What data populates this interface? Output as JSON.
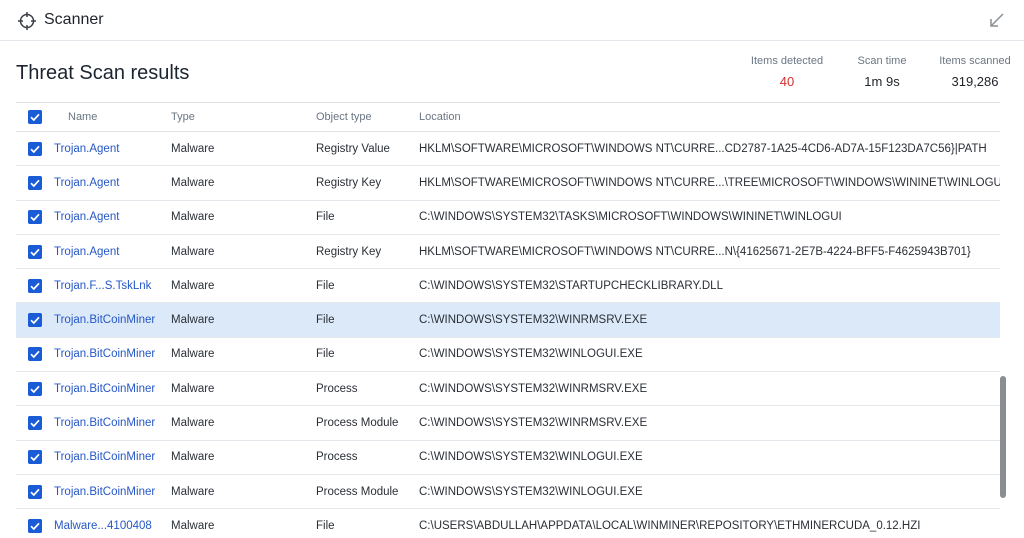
{
  "window": {
    "title": "Scanner"
  },
  "page": {
    "heading": "Threat Scan results"
  },
  "stats": {
    "detected_label": "Items detected",
    "detected_value": "40",
    "time_label": "Scan time",
    "time_value": "1m 9s",
    "scanned_label": "Items scanned",
    "scanned_value": "319,286"
  },
  "table": {
    "headers": {
      "name": "Name",
      "type": "Type",
      "object_type": "Object type",
      "location": "Location"
    },
    "rows": [
      {
        "name": "Trojan.Agent",
        "type": "Malware",
        "object_type": "Registry Value",
        "location": "HKLM\\SOFTWARE\\MICROSOFT\\WINDOWS NT\\CURRE...CD2787-1A25-4CD6-AD7A-15F123DA7C56}|PATH"
      },
      {
        "name": "Trojan.Agent",
        "type": "Malware",
        "object_type": "Registry Key",
        "location": "HKLM\\SOFTWARE\\MICROSOFT\\WINDOWS NT\\CURRE...\\TREE\\MICROSOFT\\WINDOWS\\WININET\\WINLOGUI"
      },
      {
        "name": "Trojan.Agent",
        "type": "Malware",
        "object_type": "File",
        "location": "C:\\WINDOWS\\SYSTEM32\\TASKS\\MICROSOFT\\WINDOWS\\WININET\\WINLOGUI"
      },
      {
        "name": "Trojan.Agent",
        "type": "Malware",
        "object_type": "Registry Key",
        "location": "HKLM\\SOFTWARE\\MICROSOFT\\WINDOWS NT\\CURRE...N\\{41625671-2E7B-4224-BFF5-F4625943B701}"
      },
      {
        "name": "Trojan.F...S.TskLnk",
        "type": "Malware",
        "object_type": "File",
        "location": "C:\\WINDOWS\\SYSTEM32\\STARTUPCHECKLIBRARY.DLL"
      },
      {
        "name": "Trojan.BitCoinMiner",
        "type": "Malware",
        "object_type": "File",
        "location": "C:\\WINDOWS\\SYSTEM32\\WINRMSRV.EXE"
      },
      {
        "name": "Trojan.BitCoinMiner",
        "type": "Malware",
        "object_type": "File",
        "location": "C:\\WINDOWS\\SYSTEM32\\WINLOGUI.EXE"
      },
      {
        "name": "Trojan.BitCoinMiner",
        "type": "Malware",
        "object_type": "Process",
        "location": "C:\\WINDOWS\\SYSTEM32\\WINRMSRV.EXE"
      },
      {
        "name": "Trojan.BitCoinMiner",
        "type": "Malware",
        "object_type": "Process Module",
        "location": "C:\\WINDOWS\\SYSTEM32\\WINRMSRV.EXE"
      },
      {
        "name": "Trojan.BitCoinMiner",
        "type": "Malware",
        "object_type": "Process",
        "location": "C:\\WINDOWS\\SYSTEM32\\WINLOGUI.EXE"
      },
      {
        "name": "Trojan.BitCoinMiner",
        "type": "Malware",
        "object_type": "Process Module",
        "location": "C:\\WINDOWS\\SYSTEM32\\WINLOGUI.EXE"
      },
      {
        "name": "Malware...4100408",
        "type": "Malware",
        "object_type": "File",
        "location": "C:\\USERS\\ABDULLAH\\APPDATA\\LOCAL\\WINMINER\\REPOSITORY\\ETHMINERCUDA_0.12.HZI"
      }
    ]
  },
  "colors": {
    "accent": "#1a5bd6",
    "link": "#2557c7",
    "detected": "#d32f2f",
    "selected_row": "#dce9f9"
  },
  "icons": {
    "app": "crosshair-icon",
    "window_action": "minimize-arrow-icon",
    "checkbox": "checkmark-icon"
  }
}
